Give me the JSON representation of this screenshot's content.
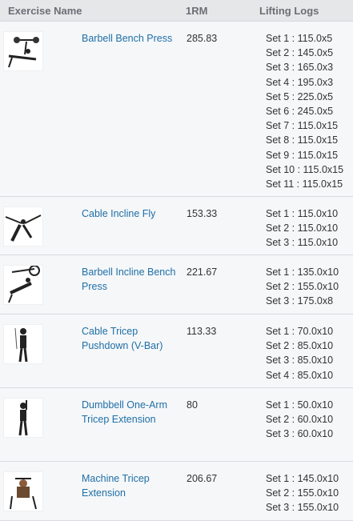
{
  "header": {
    "exercise": "Exercise Name",
    "rm": "1RM",
    "logs": "Lifting Logs"
  },
  "rows": [
    {
      "name": "Barbell Bench Press",
      "rm": "285.83",
      "icon": "bench-press-figure",
      "sets": [
        "Set 1 : 115.0x5",
        "Set 2 : 145.0x5",
        "Set 3 : 165.0x3",
        "Set 4 : 195.0x3",
        "Set 5 : 225.0x5",
        "Set 6 : 245.0x5",
        "Set 7 : 115.0x15",
        "Set 8 : 115.0x15",
        "Set 9 : 115.0x15",
        "Set 10 : 115.0x15",
        "Set 11 : 115.0x15"
      ]
    },
    {
      "name": "Cable Incline Fly",
      "rm": "153.33",
      "icon": "incline-fly-figure",
      "sets": [
        "Set 1 : 115.0x10",
        "Set 2 : 115.0x10",
        "Set 3 : 115.0x10"
      ]
    },
    {
      "name": "Barbell Incline Bench Press",
      "rm": "221.67",
      "icon": "incline-bench-figure",
      "sets": [
        "Set 1 : 135.0x10",
        "Set 2 : 155.0x10",
        "Set 3 : 175.0x8"
      ]
    },
    {
      "name": "Cable Tricep Pushdown (V-Bar)",
      "rm": "113.33",
      "icon": "tricep-pushdown-figure",
      "sets": [
        "Set 1 : 70.0x10",
        "Set 2 : 85.0x10",
        "Set 3 : 85.0x10",
        "Set 4 : 85.0x10"
      ]
    },
    {
      "name": "Dumbbell One-Arm Tricep Extension",
      "rm": "80",
      "icon": "dumbbell-extension-figure",
      "sets": [
        "Set 1 : 50.0x10",
        "Set 2 : 60.0x10",
        "Set 3 : 60.0x10"
      ]
    },
    {
      "name": "Machine Tricep Extension",
      "rm": "206.67",
      "icon": "machine-extension-figure",
      "sets": [
        "Set 1 : 145.0x10",
        "Set 2 : 155.0x10",
        "Set 3 : 155.0x10"
      ]
    }
  ]
}
